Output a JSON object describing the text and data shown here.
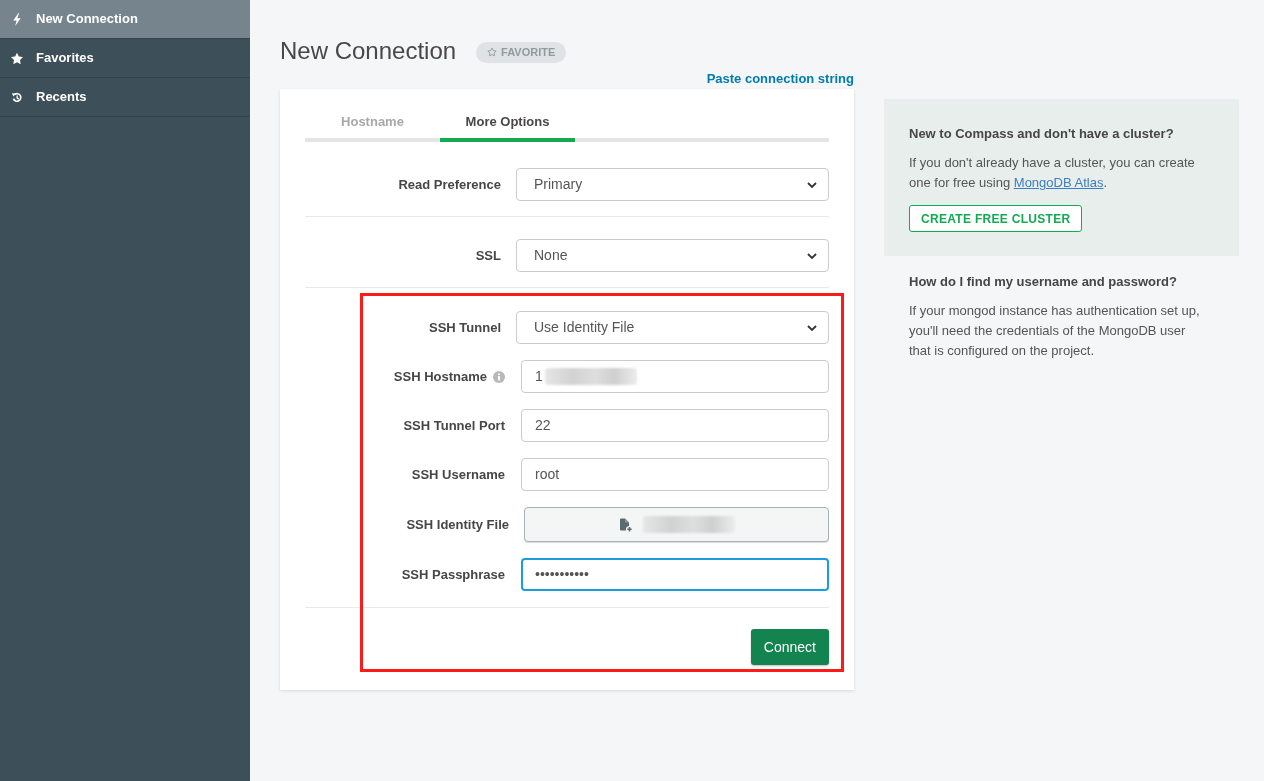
{
  "sidebar": {
    "items": [
      {
        "label": "New Connection",
        "selected": true
      },
      {
        "label": "Favorites",
        "selected": false
      },
      {
        "label": "Recents",
        "selected": false
      }
    ]
  },
  "header": {
    "title": "New Connection",
    "favorite_button": "FAVORITE"
  },
  "paste_link": "Paste connection string",
  "tabs": [
    {
      "label": "Hostname",
      "selected": false
    },
    {
      "label": "More Options",
      "selected": true
    }
  ],
  "sections": [
    {
      "fields": [
        {
          "kind": "select",
          "label": "Read Preference",
          "value": "Primary"
        }
      ]
    },
    {
      "fields": [
        {
          "kind": "select",
          "label": "SSL",
          "value": "None"
        }
      ]
    },
    {
      "highlighted": true,
      "fields": [
        {
          "kind": "select",
          "label": "SSH Tunnel",
          "value": "Use Identity File"
        },
        {
          "kind": "text",
          "label": "SSH Hostname",
          "value": "1",
          "info": true,
          "redacted": true
        },
        {
          "kind": "text",
          "label": "SSH Tunnel Port",
          "value": "22"
        },
        {
          "kind": "text",
          "label": "SSH Username",
          "value": "root"
        },
        {
          "kind": "file",
          "label": "SSH Identity File",
          "redacted": true
        },
        {
          "kind": "password",
          "label": "SSH Passphrase",
          "value": "•••••••••••",
          "focused": true
        }
      ]
    }
  ],
  "connect_button": "Connect",
  "help": {
    "cluster_box": {
      "heading": "New to Compass and don't have a cluster?",
      "text": "If you don't already have a cluster, you can create one for free using ",
      "link": "MongoDB Atlas",
      "text_after": ".",
      "button": "CREATE FREE CLUSTER"
    },
    "credentials": {
      "heading": "How do I find my username and password?",
      "text": "If your mongod instance has authentication set up, you'll need the credentials of the MongoDB user that is configured on the project."
    }
  }
}
